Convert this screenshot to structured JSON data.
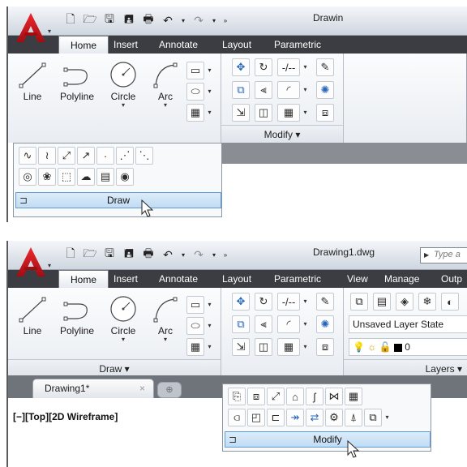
{
  "shot1": {
    "title_fragment": "Drawin",
    "tabs": [
      "Home",
      "Insert",
      "Annotate",
      "Layout",
      "Parametric"
    ],
    "tools": [
      "Line",
      "Polyline",
      "Circle",
      "Arc"
    ],
    "modify_panel_title": "Modify",
    "draw_flyout_label": "Draw"
  },
  "shot2": {
    "title": "Drawing1.dwg",
    "search_placeholder": "Type a",
    "tabs": [
      "Home",
      "Insert",
      "Annotate",
      "Layout",
      "Parametric",
      "View",
      "Manage",
      "Outp"
    ],
    "tools": [
      "Line",
      "Polyline",
      "Circle",
      "Arc"
    ],
    "draw_panel_title": "Draw",
    "layers_panel_title": "Layers",
    "layer_state": "Unsaved Layer State",
    "current_layer": "0",
    "file_tab": "Drawing1*",
    "file_tab_close": "×",
    "viewport_label": "[−][Top][2D Wireframe]",
    "modify_flyout_label": "Modify"
  },
  "icons": {
    "app": "autocad-logo-icon",
    "quick_access": [
      "new-icon",
      "open-icon",
      "save-icon",
      "save-as-icon",
      "print-icon",
      "undo-icon",
      "redo-icon",
      "more-icon"
    ],
    "colors": {
      "tabbar": "#3b3d42",
      "flyout_highlight": "#c1dcf4",
      "app_red": "#c8141b"
    }
  }
}
